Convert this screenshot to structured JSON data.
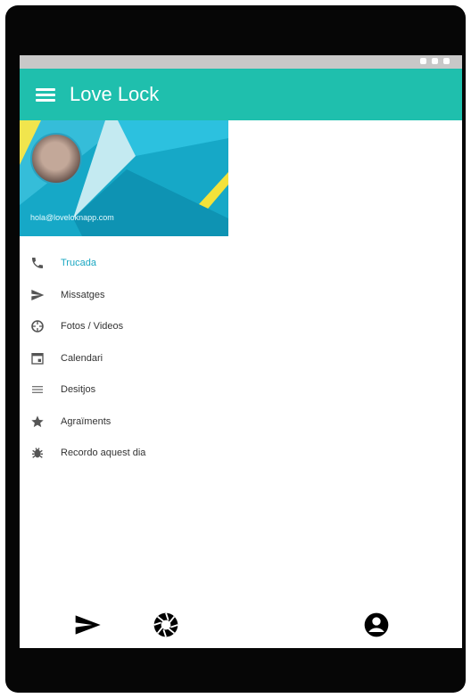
{
  "app_title": "Love Lock",
  "drawer": {
    "email": "hola@loveloknapp.com",
    "items": [
      {
        "label": "Trucada",
        "icon": "phone-icon"
      },
      {
        "label": "Missatges",
        "icon": "send-icon"
      },
      {
        "label": "Fotos / Videos",
        "icon": "camera-aperture-icon"
      },
      {
        "label": "Calendari",
        "icon": "calendar-icon"
      },
      {
        "label": "Desitjos",
        "icon": "list-icon"
      },
      {
        "label": "Agraïments",
        "icon": "star-icon"
      },
      {
        "label": "Recordo aquest dia",
        "icon": "bug-icon"
      }
    ]
  },
  "bottom_bar": [
    "send-icon",
    "camera-aperture-icon",
    "account-circle-icon"
  ],
  "colors": {
    "app_bar": "#1fbfad",
    "active": "#1aa7c2"
  }
}
